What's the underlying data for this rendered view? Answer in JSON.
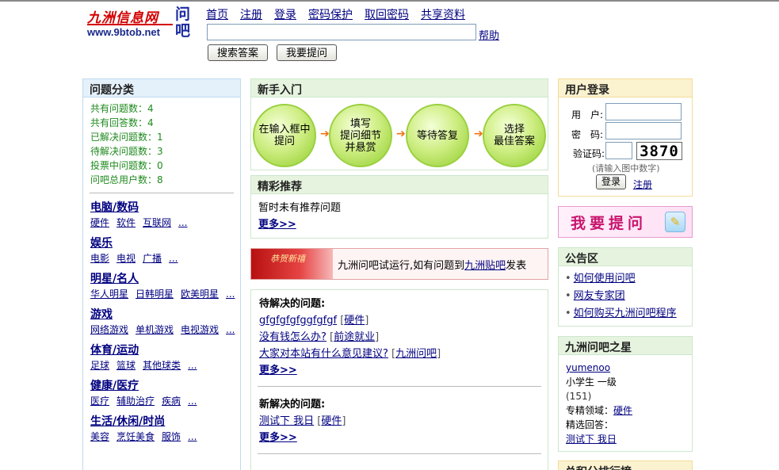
{
  "header": {
    "logo_cn": "九洲信息网",
    "logo_url": "www.9btob.net",
    "logo_mark": "问吧",
    "nav": [
      "首页",
      "注册",
      "登录",
      "密码保护",
      "取回密码",
      "共享资料"
    ],
    "search_value": "",
    "help_label": "帮助",
    "search_button": "搜索答案",
    "ask_button": "我要提问"
  },
  "left": {
    "title": "问题分类",
    "stats": [
      "共有问题数：4",
      "共有回答数：4",
      "已解决问题数：1",
      "待解决问题数：3",
      "投票中问题数：0",
      "问吧总用户数：8"
    ],
    "categories": [
      {
        "title": "电脑/数码",
        "links": [
          "硬件",
          "软件",
          "互联网",
          "..."
        ]
      },
      {
        "title": "娱乐",
        "links": [
          "电影",
          "电视",
          "广播",
          "..."
        ]
      },
      {
        "title": "明星/名人",
        "links": [
          "华人明星",
          "日韩明星",
          "欧美明星",
          "..."
        ]
      },
      {
        "title": "游戏",
        "links": [
          "网络游戏",
          "单机游戏",
          "电视游戏",
          "..."
        ]
      },
      {
        "title": "体育/运动",
        "links": [
          "足球",
          "篮球",
          "其他球类",
          "..."
        ]
      },
      {
        "title": "健康/医疗",
        "links": [
          "医疗",
          "辅助治疗",
          "疾病",
          "..."
        ]
      },
      {
        "title": "生活/休闲/时尚",
        "links": [
          "美容",
          "烹饪美食",
          "服饰",
          "..."
        ]
      }
    ]
  },
  "newbie": {
    "title": "新手入门",
    "steps": [
      "在输入框中\n提问",
      "填写\n提问细节\n并悬赏",
      "等待答复",
      "选择\n最佳答案"
    ],
    "arrow": "➔"
  },
  "featured": {
    "title": "精彩推荐",
    "empty_text": "暂时未有推荐问题",
    "more": "更多>>"
  },
  "banner": {
    "image_text": "恭贺新禧",
    "text_before": "九洲问吧试运行,如有问题到",
    "link": "九洲贴吧",
    "text_after": "发表"
  },
  "questions": {
    "pending_title": "待解决的问题:",
    "pending": [
      {
        "q": "gfgfgfgfggfgfgf",
        "tag": "硬件"
      },
      {
        "q": "没有钱怎么办?",
        "tag": "前途就业"
      },
      {
        "q": "大家对本站有什么意见建议?",
        "tag": "九洲问吧"
      }
    ],
    "pending_more": "更多>>",
    "solved_title": "新解决的问题:",
    "solved": [
      {
        "q": "测试下 我日",
        "tag": "硬件"
      }
    ],
    "solved_more": "更多>>"
  },
  "login": {
    "title": "用户登录",
    "user_label": "用　户:",
    "pass_label": "密　码:",
    "code_label": "验证码:",
    "captcha": "3870",
    "hint": "(请输入图中数字)",
    "login_button": "登录",
    "register": "注册"
  },
  "ask_banner": {
    "text": "我要提问"
  },
  "notice": {
    "title": "公告区",
    "items": [
      "如何使用问吧",
      "网友专家团",
      "如何购买九洲问吧程序"
    ]
  },
  "star": {
    "title": "九洲问吧之星",
    "username": "yumenoo",
    "level": "小学生 一级",
    "points": "(151)",
    "field_label": "专精领域：",
    "field": "硬件",
    "best_label": "精选回答：",
    "best": "测试下 我日"
  },
  "rank": {
    "title": "总积分排行榜"
  },
  "colors": {
    "link": "#000080",
    "stat_green": "#1e8a1e",
    "panel_green": "#e6f4df",
    "panel_blue": "#e4f1fb",
    "panel_yellow": "#fbf2cf",
    "arrow_orange": "#f07010",
    "logo_red": "#d40000"
  }
}
